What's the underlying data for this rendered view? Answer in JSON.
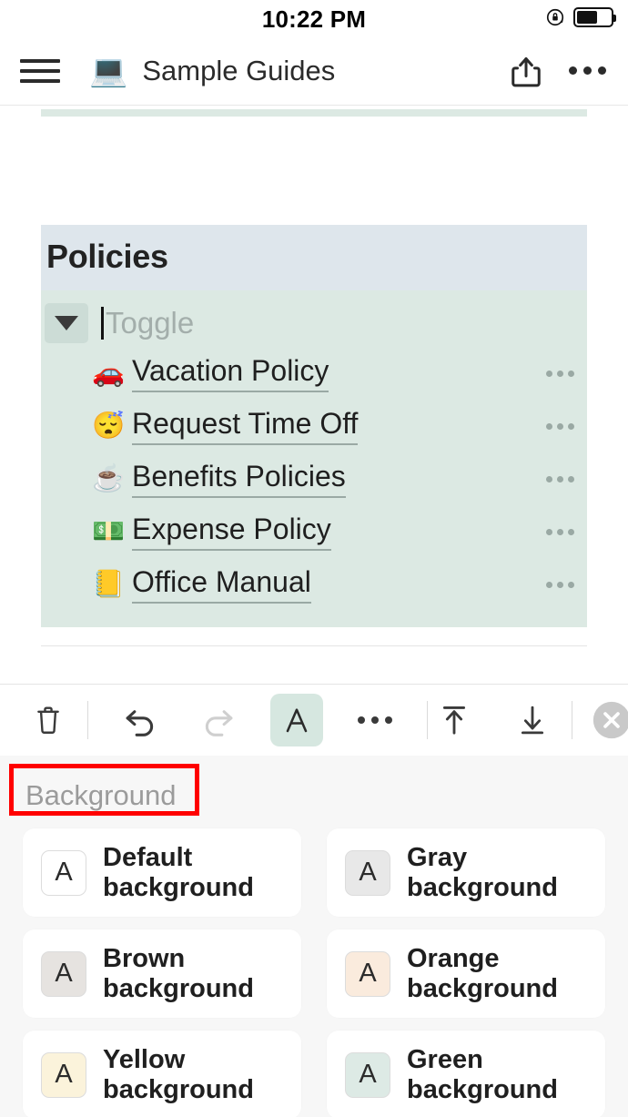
{
  "status_bar": {
    "time": "10:22 PM",
    "rotation_lock_icon": "rotation-lock-icon",
    "battery_icon": "battery-icon",
    "battery_level_percent": 60
  },
  "header": {
    "menu_icon": "hamburger-menu-icon",
    "doc_emoji": "💻",
    "title": "Sample Guides",
    "share_icon": "share-icon",
    "more_icon": "more-options-icon"
  },
  "document": {
    "section_title": "Policies",
    "section_title_bg": "#dee6ec",
    "toggle": {
      "arrow_icon": "toggle-collapse-arrow-icon",
      "placeholder": "Toggle",
      "block_bg": "#dce9e3"
    },
    "items": [
      {
        "emoji": "🚗",
        "label": "Vacation Policy",
        "more_icon": "item-more-icon"
      },
      {
        "emoji": "😴",
        "label": "Request Time Off",
        "more_icon": "item-more-icon"
      },
      {
        "emoji": "☕",
        "label": "Benefits Policies",
        "more_icon": "item-more-icon"
      },
      {
        "emoji": "💵",
        "label": "Expense Policy",
        "more_icon": "item-more-icon"
      },
      {
        "emoji": "📒",
        "label": "Office Manual",
        "more_icon": "item-more-icon"
      }
    ]
  },
  "toolbar": {
    "delete_icon": "trash-icon",
    "undo_icon": "undo-icon",
    "redo_icon": "redo-icon",
    "redo_disabled": true,
    "format_icon": "text-format-a-icon",
    "format_active": true,
    "format_active_bg": "#d6e7e0",
    "more_icon": "more-options-icon",
    "move_up_icon": "move-to-top-icon",
    "move_down_icon": "move-down-icon",
    "close_icon": "close-circle-icon"
  },
  "background_panel": {
    "label": "Background",
    "annotation_color": "#ff0000",
    "options": [
      {
        "label_line1": "Default",
        "label_line2": "background",
        "swatch_letter": "A",
        "swatch_color": "#ffffff"
      },
      {
        "label_line1": "Gray",
        "label_line2": "background",
        "swatch_letter": "A",
        "swatch_color": "#e8e8e8"
      },
      {
        "label_line1": "Brown",
        "label_line2": "background",
        "swatch_letter": "A",
        "swatch_color": "#e6e3e0"
      },
      {
        "label_line1": "Orange",
        "label_line2": "background",
        "swatch_letter": "A",
        "swatch_color": "#faebdd"
      },
      {
        "label_line1": "Yellow",
        "label_line2": "background",
        "swatch_letter": "A",
        "swatch_color": "#fbf3db"
      },
      {
        "label_line1": "Green",
        "label_line2": "background",
        "swatch_letter": "A",
        "swatch_color": "#ddeae5"
      }
    ]
  }
}
